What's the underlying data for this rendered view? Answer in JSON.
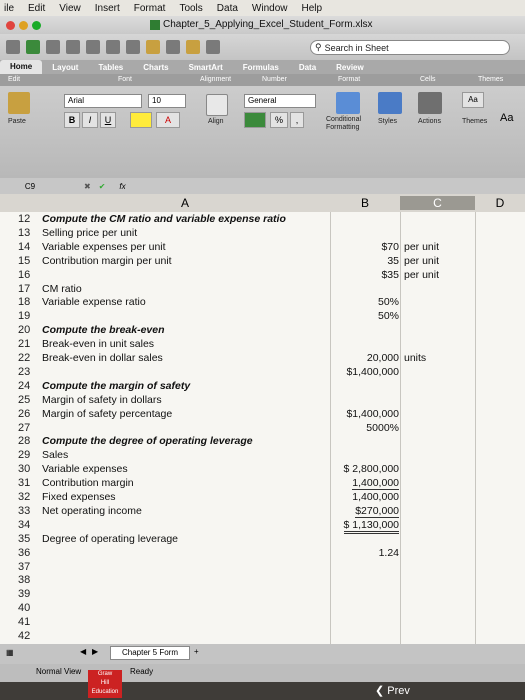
{
  "menubar": {
    "items": [
      "ile",
      "Edit",
      "View",
      "Insert",
      "Format",
      "Tools",
      "Data",
      "Window",
      "Help"
    ]
  },
  "window": {
    "title": "Chapter_5_Applying_Excel_Student_Form.xlsx"
  },
  "toolbar": {
    "search_placeholder": "Search in Sheet"
  },
  "ribbon": {
    "tabs": [
      "Home",
      "Layout",
      "Tables",
      "Charts",
      "SmartArt",
      "Formulas",
      "Data",
      "Review"
    ],
    "active_tab": "Home",
    "groups": [
      "Edit",
      "Font",
      "Alignment",
      "Number",
      "Format",
      "Cells",
      "Themes"
    ],
    "font_name": "Arial",
    "font_size": "10",
    "number_format": "General",
    "paste_label": "Paste",
    "align_label": "Align",
    "cond_format_label": "Conditional Formatting",
    "styles_label": "Styles",
    "actions_label": "Actions",
    "themes_label": "Themes",
    "bold": "B",
    "italic": "I",
    "underline": "U",
    "percent": "%",
    "comma": ",",
    "aa": "Aa"
  },
  "formula_bar": {
    "cell_ref": "C9",
    "fx": "fx"
  },
  "columns": {
    "a": "A",
    "b": "B",
    "c": "C",
    "d": "D"
  },
  "rows": [
    {
      "n": "12",
      "a": "Compute the CM ratio and variable expense ratio",
      "a_style": "bi",
      "b": "",
      "c": ""
    },
    {
      "n": "13",
      "a": "Selling price per unit",
      "b": "",
      "c": ""
    },
    {
      "n": "14",
      "a": "Variable expenses per unit",
      "b": "$70",
      "c": "per unit"
    },
    {
      "n": "15",
      "a": "Contribution margin per unit",
      "b": "35",
      "c": "per unit"
    },
    {
      "n": "16",
      "a": "",
      "b": "$35",
      "c": "per unit"
    },
    {
      "n": "17",
      "a": "CM ratio",
      "b": "",
      "c": ""
    },
    {
      "n": "18",
      "a": "Variable expense ratio",
      "b": "50%",
      "c": ""
    },
    {
      "n": "19",
      "a": "",
      "b": "50%",
      "c": ""
    },
    {
      "n": "20",
      "a": "Compute the break-even",
      "a_style": "bi",
      "b": "",
      "c": ""
    },
    {
      "n": "21",
      "a": "Break-even in unit sales",
      "b": "",
      "c": ""
    },
    {
      "n": "22",
      "a": "Break-even in dollar sales",
      "b": "20,000",
      "c": "units"
    },
    {
      "n": "23",
      "a": "",
      "b": "$1,400,000",
      "c": ""
    },
    {
      "n": "24",
      "a": "Compute the margin of safety",
      "a_style": "bi",
      "b": "",
      "c": ""
    },
    {
      "n": "25",
      "a": "Margin of safety in dollars",
      "b": "",
      "c": ""
    },
    {
      "n": "26",
      "a": "Margin of safety percentage",
      "b": "$1,400,000",
      "c": ""
    },
    {
      "n": "27",
      "a": "",
      "b": "5000%",
      "c": ""
    },
    {
      "n": "28",
      "a": "Compute the degree of operating leverage",
      "a_style": "bi",
      "b": "",
      "c": ""
    },
    {
      "n": "29",
      "a": "Sales",
      "b": "",
      "c": ""
    },
    {
      "n": "30",
      "a": "Variable expenses",
      "b": "$ 2,800,000",
      "c": ""
    },
    {
      "n": "31",
      "a": "Contribution margin",
      "b": "1,400,000",
      "b_style": "ul",
      "c": ""
    },
    {
      "n": "32",
      "a": "Fixed expenses",
      "b": "1,400,000",
      "c": ""
    },
    {
      "n": "33",
      "a": "Net operating income",
      "b": "$270,000",
      "b_style": "ul",
      "c": ""
    },
    {
      "n": "34",
      "a": "",
      "b": "$ 1,130,000",
      "b_style": "dul",
      "c": ""
    },
    {
      "n": "35",
      "a": "Degree of operating leverage",
      "b": "",
      "c": ""
    },
    {
      "n": "36",
      "a": "",
      "b": "1.24",
      "c": ""
    },
    {
      "n": "37",
      "a": "",
      "b": "",
      "c": ""
    },
    {
      "n": "38",
      "a": "",
      "b": "",
      "c": ""
    },
    {
      "n": "39",
      "a": "",
      "b": "",
      "c": ""
    },
    {
      "n": "40",
      "a": "",
      "b": "",
      "c": ""
    },
    {
      "n": "41",
      "a": "",
      "b": "",
      "c": ""
    },
    {
      "n": "42",
      "a": "",
      "b": "",
      "c": ""
    }
  ],
  "sheet_tab": "Chapter 5 Form",
  "status": {
    "view": "Normal View",
    "ready": "Ready"
  },
  "nav": {
    "prev": "Prev"
  },
  "logo": {
    "lines": [
      "Graw",
      "Hill",
      "Education"
    ]
  }
}
